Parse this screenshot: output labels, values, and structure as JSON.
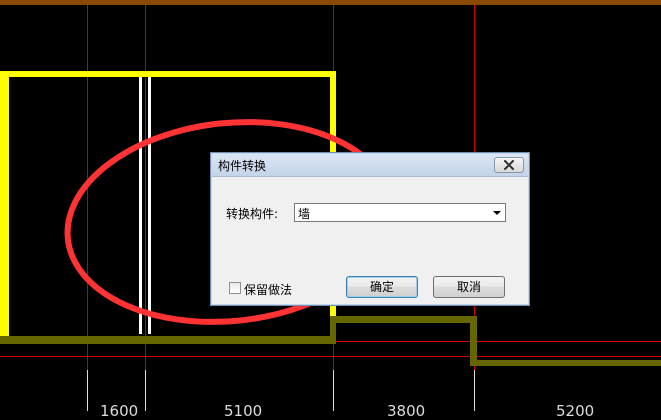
{
  "cad_view": {
    "dimension_labels": [
      "1600",
      "5100",
      "3800",
      "5200"
    ]
  },
  "dialog": {
    "title": "构件转换",
    "convert_label": "转换构件:",
    "component_value": "墙",
    "keep_method_label": "保留做法",
    "keep_method_checked": false,
    "ok_label": "确定",
    "cancel_label": "取消"
  },
  "colors": {
    "background": "#000000",
    "grid_line": "#cc0000",
    "wall_outline": "#ffff00",
    "beam": "#666600",
    "annotation_ellipse": "#ff3333"
  }
}
